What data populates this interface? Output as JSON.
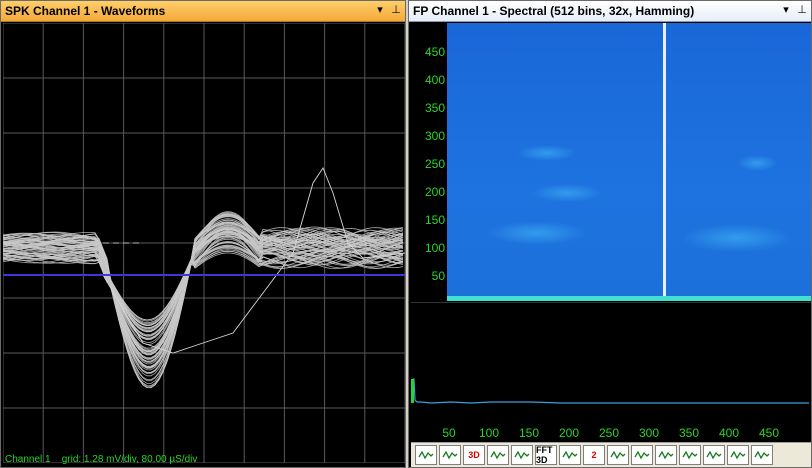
{
  "left_panel": {
    "title": "SPK Channel 1 - Waveforms",
    "status": "Channel 1    grid: 1.28 mV/div, 80.00 µS/div"
  },
  "right_panel": {
    "title": "FP Channel 1 - Spectral (512 bins, 32x, Hamming)",
    "y_ticks": [
      "450",
      "400",
      "350",
      "300",
      "250",
      "200",
      "150",
      "100",
      "50"
    ],
    "x_ticks": [
      "50",
      "100",
      "150",
      "200",
      "250",
      "300",
      "350",
      "400",
      "450"
    ]
  },
  "titlebar_icons": [
    "dropdown-icon",
    "pin-icon"
  ],
  "toolbar": {
    "buttons": [
      {
        "name": "waveform-view-icon",
        "label": ""
      },
      {
        "name": "color-map-icon",
        "label": ""
      },
      {
        "name": "3d-view-icon",
        "label": "3D"
      },
      {
        "name": "spectrum-overlay-icon",
        "label": ""
      },
      {
        "name": "spectrum-stack-icon",
        "label": ""
      },
      {
        "name": "fft-3d-icon",
        "label": "FFT 3D"
      },
      {
        "name": "grid-view-icon",
        "label": ""
      },
      {
        "name": "two-channel-icon",
        "label": "2"
      },
      {
        "name": "wave-filter-icon",
        "label": ""
      },
      {
        "name": "wave-compare-icon",
        "label": ""
      },
      {
        "name": "wave-peak-icon",
        "label": ""
      },
      {
        "name": "wave-average-icon",
        "label": ""
      },
      {
        "name": "wave-band-icon",
        "label": ""
      },
      {
        "name": "bar-graph-icon",
        "label": ""
      },
      {
        "name": "wave-settings-icon",
        "label": ""
      }
    ]
  },
  "colors": {
    "trace": "#c8c8c8",
    "grid": "#5a5a5a",
    "baseline": "#3a3ad8",
    "axis_text": "#2ad42a",
    "spectrogram": "#1e6fe0",
    "spectrum_line": "#3a9fe0"
  }
}
